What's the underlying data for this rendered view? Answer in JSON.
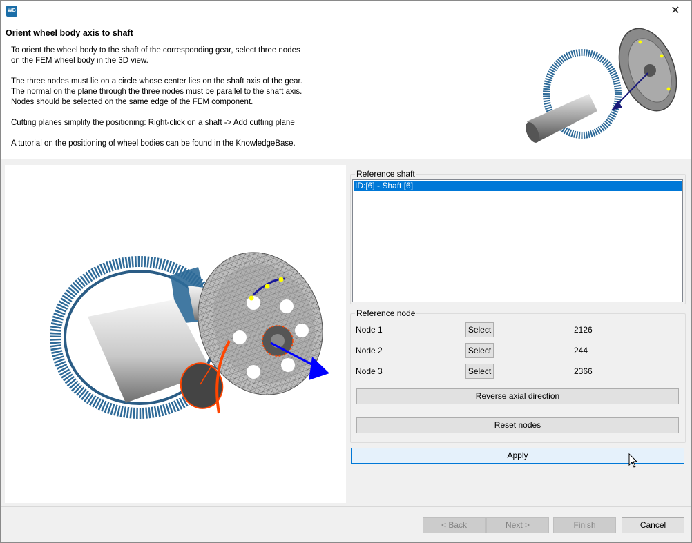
{
  "window": {
    "app_icon_text": "WB"
  },
  "header": {
    "title": "Orient wheel body axis to shaft",
    "paragraphs": [
      "To orient the wheel body to the shaft of the corresponding gear, select three nodes\non the FEM wheel body in the 3D view.",
      "The three nodes must lie on a circle whose center lies on the shaft axis of the gear.\nThe normal on the plane through the three nodes must be parallel to the shaft axis.\nNodes should be selected on the same edge of the FEM component.",
      "Cutting planes simplify the positioning: Right-click on a shaft -> Add cutting plane",
      "A tutorial on the positioning of wheel bodies can be found in the KnowledgeBase."
    ]
  },
  "reference_shaft": {
    "title": "Reference shaft",
    "items": [
      "ID:[6] - Shaft [6]"
    ]
  },
  "reference_node": {
    "title": "Reference node",
    "nodes": [
      {
        "label": "Node 1",
        "button": "Select",
        "value": "2126"
      },
      {
        "label": "Node 2",
        "button": "Select",
        "value": "244"
      },
      {
        "label": "Node 3",
        "button": "Select",
        "value": "2366"
      }
    ],
    "reverse_label": "Reverse axial direction",
    "reset_label": "Reset nodes"
  },
  "apply_label": "Apply",
  "footer": {
    "back": "< Back",
    "next": "Next >",
    "finish": "Finish",
    "cancel": "Cancel"
  },
  "colors": {
    "gear_blue": "#2e6a98",
    "selection_blue": "#0078d7",
    "node_yellow": "#ffff00",
    "highlight_orange": "#ff4500"
  }
}
